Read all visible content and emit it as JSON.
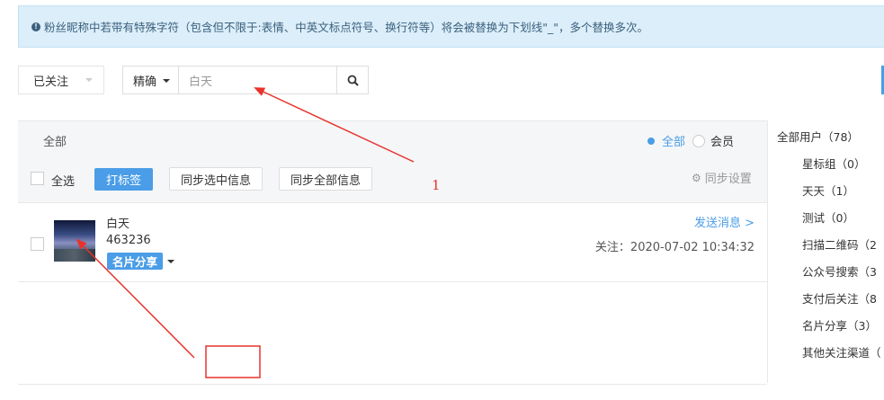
{
  "notice": {
    "icon": "info-circle-icon",
    "text": "粉丝昵称中若带有特殊字符（包含但不限于:表情、中英文标点符号、换行符等）将会被替换为下划线\"_\"，多个替换多次。"
  },
  "toolbar": {
    "status_select": "已关注",
    "match_select": "精确",
    "search_value": "白天",
    "search_icon": "search-icon"
  },
  "panel": {
    "filter_label": "全部",
    "radio_all_label": "全部",
    "radio_member_label": "会员",
    "select_all_label": "全选",
    "tag_button": "打标签",
    "sync_selected_button": "同步选中信息",
    "sync_all_button": "同步全部信息",
    "sync_settings": "同步设置",
    "sync_settings_icon": "gear-icon"
  },
  "fans": [
    {
      "name": "白天",
      "id": "463236",
      "tag": "名片分享",
      "send_message": "发送消息 >",
      "follow_time": "关注：2020-07-02 10:34:32"
    }
  ],
  "sidebar": {
    "items": [
      "全部用户（78）",
      "星标组（0）",
      "天天（1）",
      "测试（0）",
      "扫描二维码（2",
      "公众号搜索（3",
      "支付后关注（8",
      "名片分享（3）",
      "其他关注渠道（"
    ]
  },
  "annotations": {
    "label_1": "1"
  },
  "colors": {
    "accent": "#4a9de6",
    "notice_bg": "#dbeefa",
    "annotation_red": "#e8332b"
  }
}
